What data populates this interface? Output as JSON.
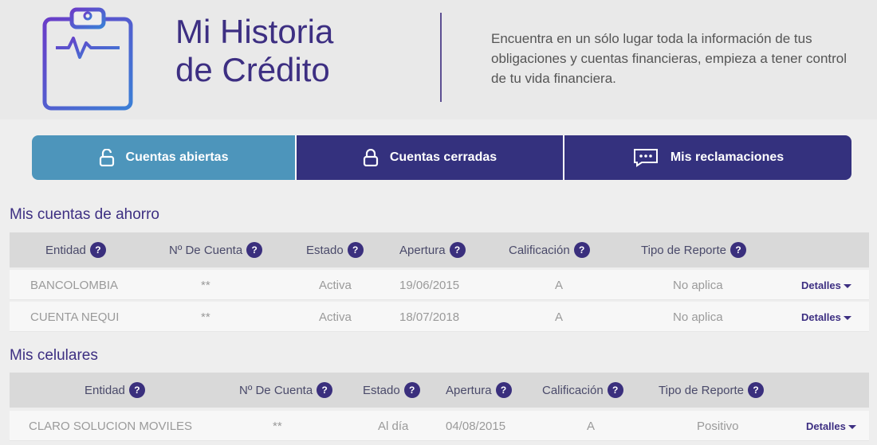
{
  "header": {
    "title_line1": "Mi Historia",
    "title_line2": "de Crédito",
    "description": "Encuentra en un sólo lugar toda la información de tus obligaciones y cuentas financieras, empieza a tener control de tu vida financiera."
  },
  "tabs": [
    {
      "label": "Cuentas abiertas",
      "icon": "unlock-icon",
      "active": true
    },
    {
      "label": "Cuentas cerradas",
      "icon": "lock-icon",
      "active": false
    },
    {
      "label": "Mis reclamaciones",
      "icon": "chat-icon",
      "active": false
    }
  ],
  "help_glyph": "?",
  "savings": {
    "title": "Mis cuentas de ahorro",
    "columns": [
      "Entidad",
      "Nº De Cuenta",
      "Estado",
      "Apertura",
      "Calificación",
      "Tipo de Reporte"
    ],
    "rows": [
      {
        "entidad": "BANCOLOMBIA",
        "cuenta": "**",
        "estado": "Activa",
        "apertura": "19/06/2015",
        "calificacion": "A",
        "tipo": "No aplica",
        "detalles": "Detalles"
      },
      {
        "entidad": "CUENTA NEQUI",
        "cuenta": "**",
        "estado": "Activa",
        "apertura": "18/07/2018",
        "calificacion": "A",
        "tipo": "No aplica",
        "detalles": "Detalles"
      }
    ]
  },
  "phones": {
    "title": "Mis celulares",
    "columns": [
      "Entidad",
      "Nº De Cuenta",
      "Estado",
      "Apertura",
      "Calificación",
      "Tipo de Reporte"
    ],
    "rows": [
      {
        "entidad": "CLARO SOLUCION MOVILES",
        "cuenta": "**",
        "estado": "Al día",
        "apertura": "04/08/2015",
        "calificacion": "A",
        "tipo": "Positivo",
        "detalles": "Detalles"
      }
    ]
  },
  "colors": {
    "primary": "#34317e",
    "active_tab": "#4d95bb",
    "title": "#3d2f82"
  }
}
